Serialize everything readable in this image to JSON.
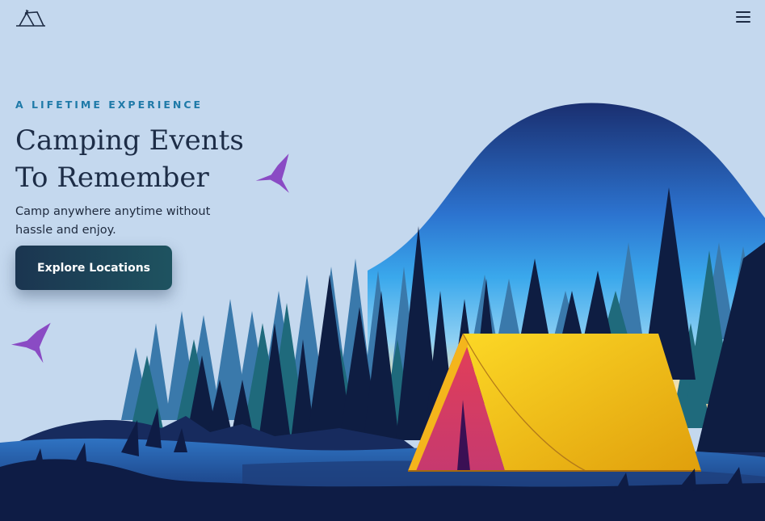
{
  "header": {
    "logo_icon": "tent-logo-icon",
    "menu_icon": "hamburger-menu-icon"
  },
  "hero": {
    "eyebrow": "A LIFETIME EXPERIENCE",
    "title_line1": "Camping Events",
    "title_line2": "To Remember",
    "subtitle_line1": "Camp anywhere anytime without",
    "subtitle_line2": "hassle and enjoy.",
    "cta_label": "Explore Locations"
  },
  "illustration": {
    "birds": [
      "hummingbird-icon",
      "hummingbird-icon"
    ],
    "tent": "tent-illustration",
    "colors": {
      "background": "#c4d8ee",
      "sky_top": "#1a2f70",
      "sky_mid": "#3aa8ec",
      "sky_glow": "#f7e0a8",
      "tent_yellow": "#f9c31a",
      "tent_door": "#d63d63",
      "bird": "#8a4bc4",
      "ground": "#0e1c45"
    }
  }
}
